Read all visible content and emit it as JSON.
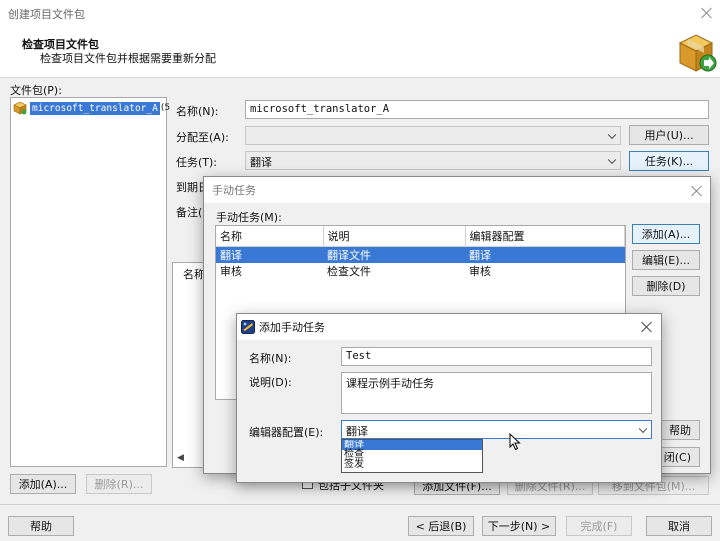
{
  "window": {
    "title": "创建项目文件包",
    "header_title": "检查项目文件包",
    "header_subtitle": "检查项目文件包并根据需要重新分配"
  },
  "packages": {
    "label": "文件包(P):",
    "items": [
      {
        "name": "microsoft_translator_A",
        "suffix": "(5"
      }
    ],
    "add_label": "添加(A)...",
    "delete_label": "删除(R)..."
  },
  "form": {
    "name_label": "名称(N):",
    "name_value": "microsoft_translator_A",
    "assign_label": "分配至(A):",
    "assign_value": "",
    "users_button": "用户(U)...",
    "task_label": "任务(T):",
    "task_value": "翻译",
    "tasks_button": "任务(K)...",
    "due_label": "到期日",
    "notes_label": "备注(",
    "files_col_label": "名称",
    "include_files_label": "包括子文件夹",
    "add_files_button": "添加文件(F)...",
    "remove_files_button": "删除文件(R)...",
    "move_to_button": "移到文件包(M)..."
  },
  "footer": {
    "help": "帮助",
    "back": "< 后退(B)",
    "next": "下一步(N) >",
    "finish": "完成(F)",
    "cancel": "取消"
  },
  "manual_tasks_dialog": {
    "title": "手动任务",
    "list_label": "手动任务(M):",
    "columns": [
      "名称",
      "说明",
      "编辑器配置"
    ],
    "rows": [
      {
        "name": "翻译",
        "desc": "翻译文件",
        "config": "翻译"
      },
      {
        "name": "审核",
        "desc": "检查文件",
        "config": "审核"
      }
    ],
    "add": "添加(A)...",
    "edit": "编辑(E)...",
    "delete": "删除(D)",
    "help_partial": "帮助",
    "close_partial": "闭(C)"
  },
  "add_task_dialog": {
    "title": "添加手动任务",
    "name_label": "名称(N):",
    "name_value": "Test",
    "desc_label": "说明(D):",
    "desc_value": "课程示例手动任务",
    "config_label": "编辑器配置(E):",
    "config_value": "翻译",
    "config_options": [
      "翻译",
      "检查",
      "签发"
    ]
  },
  "colors": {
    "selection": "#3a78d6",
    "tree_selection": "#3a78d6"
  }
}
